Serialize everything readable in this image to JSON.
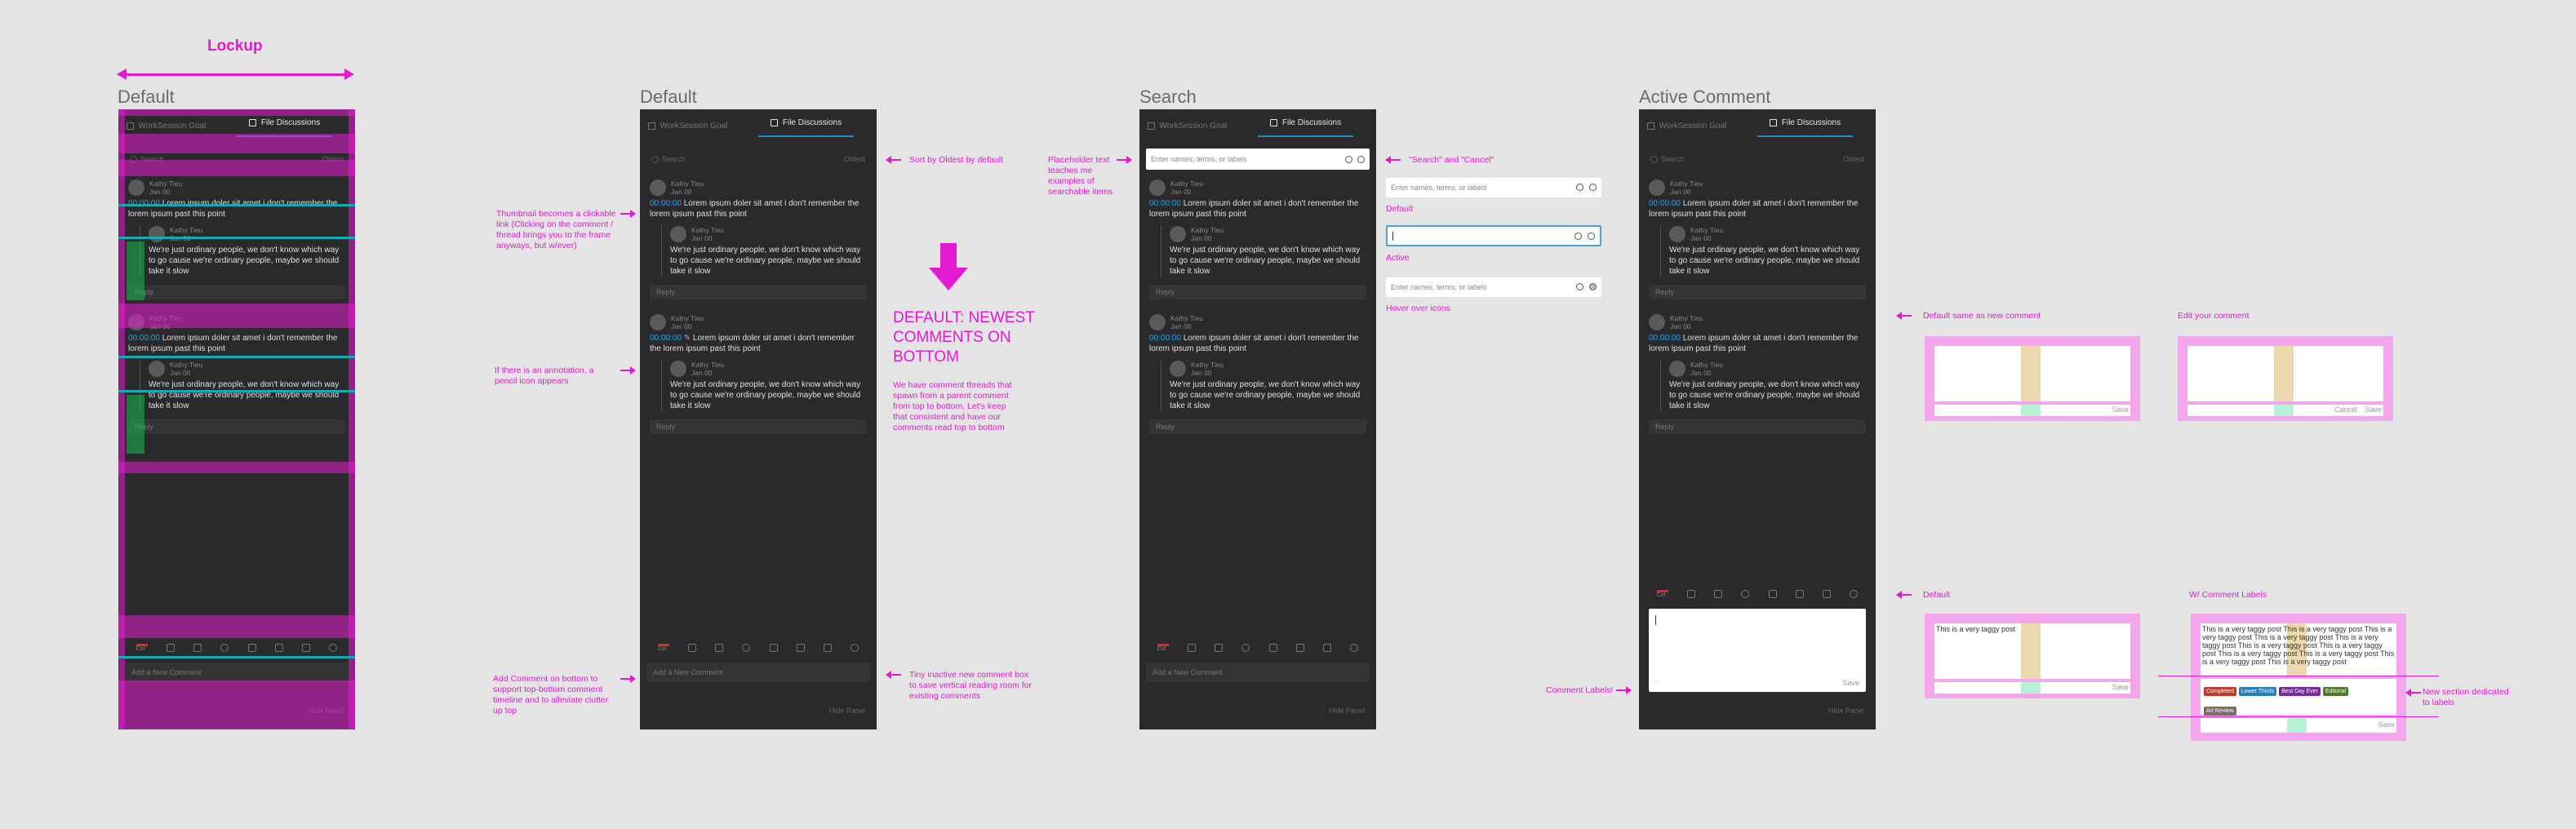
{
  "lockup": {
    "title": "Lockup"
  },
  "frames": {
    "f1": "Default",
    "f2": "Default",
    "f3": "Search",
    "f4": "Active Comment"
  },
  "panel": {
    "tab_goal": "WorkSession Goal",
    "tab_files": "File Discussions",
    "search_placeholder": "Search",
    "sort_label": "Oldest",
    "comment1": {
      "author": "Kathy Tieu",
      "date": "Jan 00",
      "timestamp": "00:00:00",
      "text": "Lorem ipsum doler sit amet i don't remember the lorem ipsum past this point"
    },
    "reply1": {
      "author": "Kathy Tieu",
      "date": "Jan 00",
      "text": "We're just ordinary people, we don't know which way to go cause we're ordinary people, maybe we should take it slow"
    },
    "reply_placeholder": "Reply",
    "add_comment_placeholder": "Add a New Comment",
    "hide_panel": "Hide Panel",
    "toolbar_color": "Col",
    "search_input_placeholder": "Enter names, terms, or labels",
    "save": "Save",
    "cancel": "Cancel"
  },
  "notes": {
    "thumbnail": "Thumbnail becomes a clickable link (Clicking on the comment / thread brings you to the frame anyways, but w/ever)",
    "annotation": "If there is an annotation, a pencil icon appears",
    "add_comment": "Add Comment on bottom to support top-bottom comment timeline and to alleviate clutter up top",
    "sort": "Sort by Oldest by default",
    "headline": "DEFAULT: NEWEST COMMENTS ON BOTTOM",
    "threads": "We have comment threads that spawn from a parent comment from top to bottom. Let's keep that consistent and have our comments read top to bottom",
    "tiny": "Tiny inactive new comment box to save vertical reading room for existing comments",
    "placeholder": "Placeholder text teaches me examples of searchable items",
    "search_cancel": "\"Search\" and \"Cancel\"",
    "default_state": "Default",
    "active_state": "Active",
    "hover_state": "Hover over icons",
    "comment_labels": "Comment Labels!",
    "default_new": "Default same as new comment",
    "edit": "Edit your comment",
    "default2": "Default",
    "w_labels": "W/ Comment Labels",
    "new_section": "New section dedicated to labels"
  },
  "taggy": {
    "short": "This is a very taggy post",
    "long": "This is a very taggy post This is a very taggy post This is a very taggy post This is a very taggy post This is a very taggy post This is a very taggy post This is a very taggy post This is a very taggy post This is a very taggy post This is a very taggy post This is a very taggy post",
    "labels": [
      "Completed",
      "Lower Thirds",
      "Best Day Ever",
      "Editorial",
      "Art Review"
    ],
    "label_colors": [
      "#c0392b",
      "#2a7fb8",
      "#7a2a9c",
      "#4a7a2a",
      "#7a6a6a"
    ]
  },
  "colors": {
    "accent": "#e21ad0",
    "panel": "#2a2a2c",
    "link": "#2d9fe0"
  }
}
